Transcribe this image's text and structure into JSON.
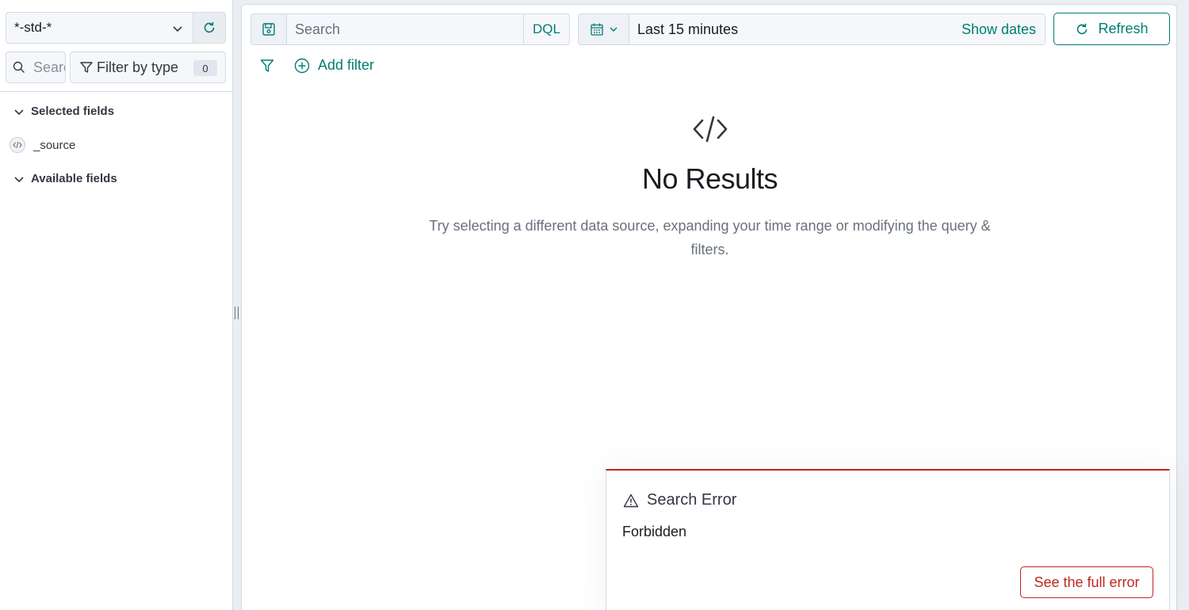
{
  "sidebar": {
    "index_pattern": "*-std-*",
    "search_placeholder": "Search field names",
    "filter_by_type_label": "Filter by type",
    "filter_count": "0",
    "selected_fields_label": "Selected fields",
    "selected_fields": [
      "_source"
    ],
    "available_fields_label": "Available fields"
  },
  "query_bar": {
    "search_placeholder": "Search",
    "language": "DQL"
  },
  "date_picker": {
    "range": "Last 15 minutes",
    "show_dates_label": "Show dates"
  },
  "refresh_label": "Refresh",
  "add_filter_label": "Add filter",
  "empty_state": {
    "title": "No Results",
    "body": "Try selecting a different data source, expanding your time range or modifying the query & filters."
  },
  "toast": {
    "title": "Search Error",
    "message": "Forbidden",
    "button_label": "See the full error"
  },
  "colors": {
    "accent": "#017d73",
    "danger": "#bd271e",
    "text": "#343741",
    "subdued": "#69707d"
  }
}
